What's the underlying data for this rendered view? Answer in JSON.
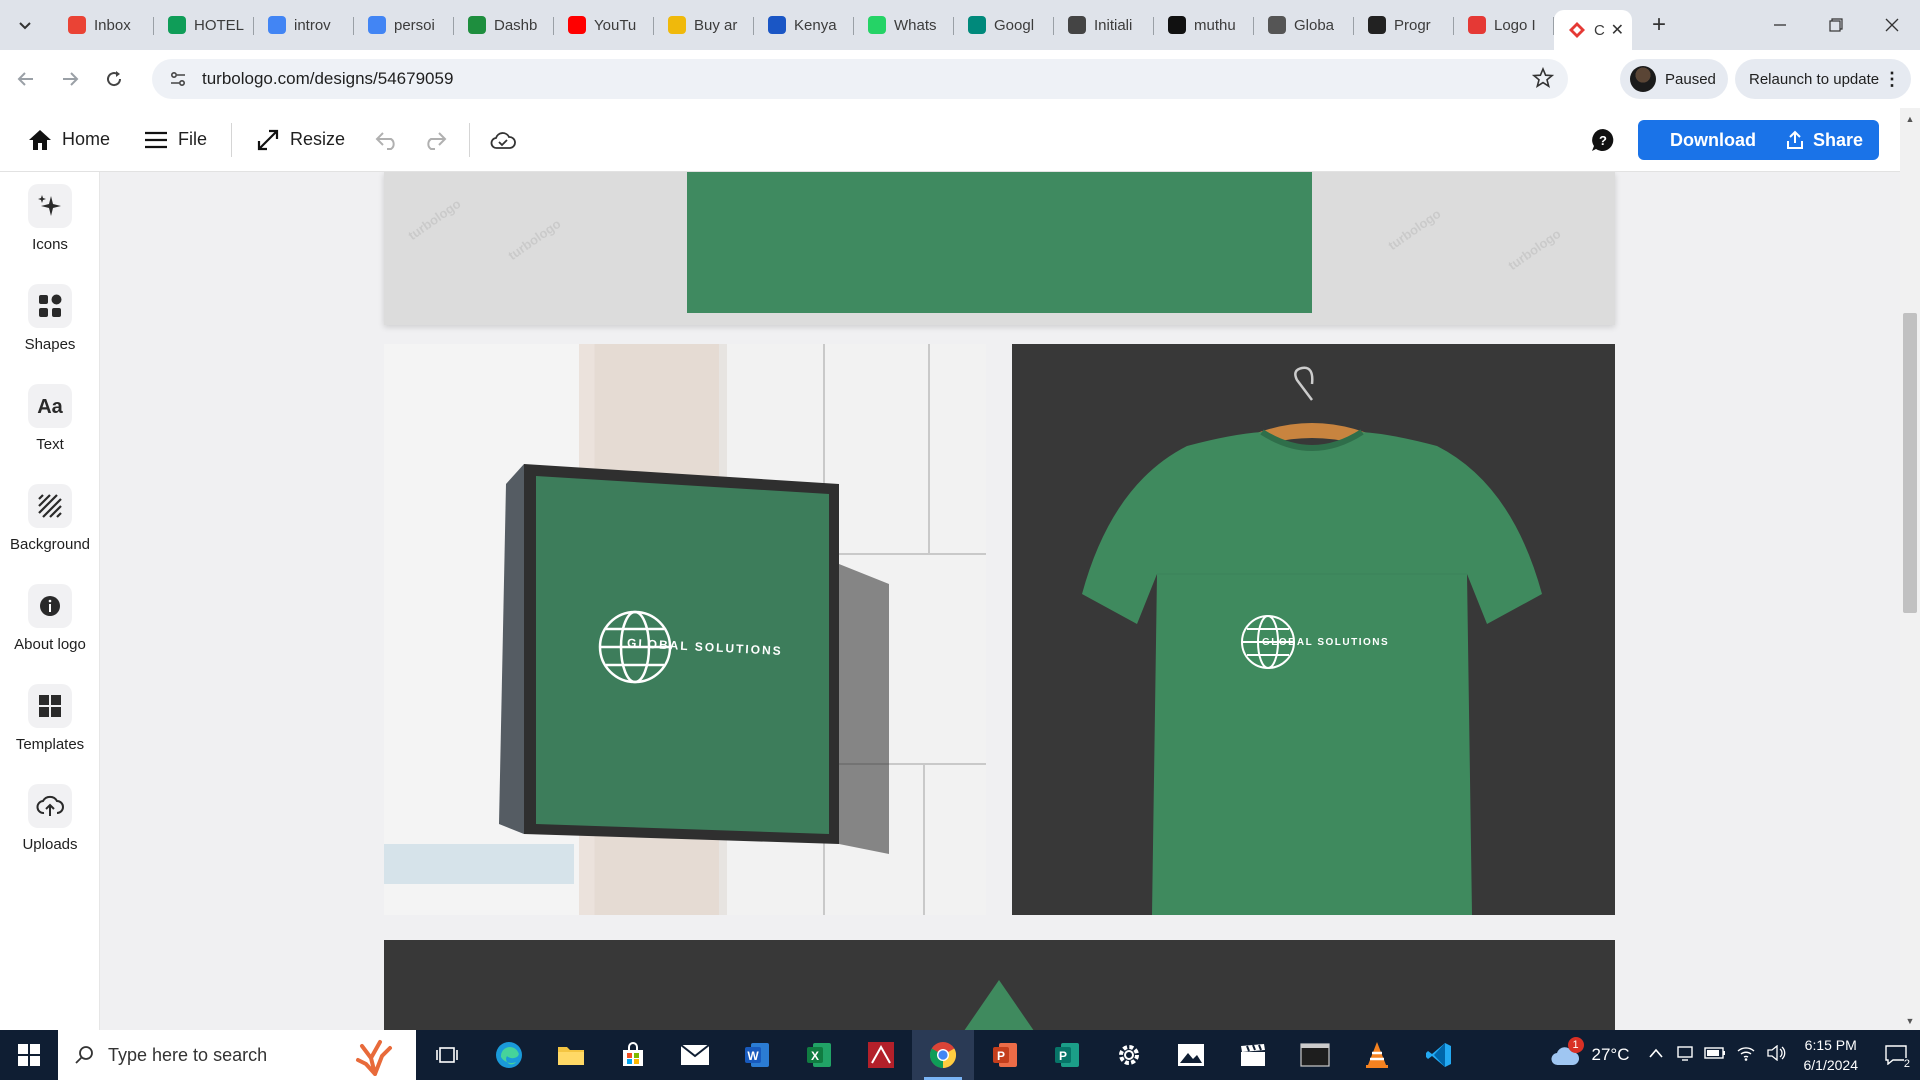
{
  "browser": {
    "tabs": [
      {
        "label": "Inbox",
        "icon": "gmail-icon",
        "color": "#ea4335"
      },
      {
        "label": "HOTEL",
        "icon": "sheets-icon",
        "color": "#0f9d58"
      },
      {
        "label": "introv",
        "icon": "google-icon",
        "color": "#4285f4"
      },
      {
        "label": "persoi",
        "icon": "google-icon",
        "color": "#4285f4"
      },
      {
        "label": "Dashb",
        "icon": "dashboard-icon",
        "color": "#1e8e3e"
      },
      {
        "label": "YouTu",
        "icon": "youtube-icon",
        "color": "#ff0000"
      },
      {
        "label": "Buy ar",
        "icon": "binance-icon",
        "color": "#f0b90b"
      },
      {
        "label": "Kenya",
        "icon": "shield-icon",
        "color": "#1a56c5"
      },
      {
        "label": "Whats",
        "icon": "whatsapp-icon",
        "color": "#25d366"
      },
      {
        "label": "Googl",
        "icon": "meet-icon",
        "color": "#00897b"
      },
      {
        "label": "Initiali",
        "icon": "openai-icon",
        "color": "#444444"
      },
      {
        "label": "muthu",
        "icon": "github-icon",
        "color": "#111111"
      },
      {
        "label": "Globa",
        "icon": "globe-icon",
        "color": "#555555"
      },
      {
        "label": "Progr",
        "icon": "progress-icon",
        "color": "#222222"
      },
      {
        "label": "Logo I",
        "icon": "turbologo-icon",
        "color": "#e53935"
      }
    ],
    "active_tab": {
      "label": "C",
      "icon": "turbologo-icon",
      "color": "#e53935"
    },
    "url": "turbologo.com/designs/54679059",
    "profile_status": "Paused",
    "relaunch_label": "Relaunch to update"
  },
  "app": {
    "home_label": "Home",
    "file_label": "File",
    "resize_label": "Resize",
    "download_label": "Download",
    "share_label": "Share",
    "accent_color": "#1a73e8"
  },
  "sidebar": {
    "items": [
      {
        "label": "Icons",
        "icon": "sparkle-icon"
      },
      {
        "label": "Shapes",
        "icon": "shapes-icon"
      },
      {
        "label": "Text",
        "icon": "text-icon"
      },
      {
        "label": "Background",
        "icon": "background-icon"
      },
      {
        "label": "About logo",
        "icon": "info-icon"
      },
      {
        "label": "Templates",
        "icon": "templates-icon"
      },
      {
        "label": "Uploads",
        "icon": "upload-cloud-icon"
      }
    ]
  },
  "canvas": {
    "brand_text": "GLOBAL SOLUTIONS",
    "watermark": "turbologo",
    "brand_color": "#3f8a60"
  },
  "taskbar": {
    "search_placeholder": "Type here to search",
    "temperature": "27°C",
    "weather_badge": "1",
    "time": "6:15 PM",
    "date": "6/1/2024",
    "notification_count": "2"
  }
}
